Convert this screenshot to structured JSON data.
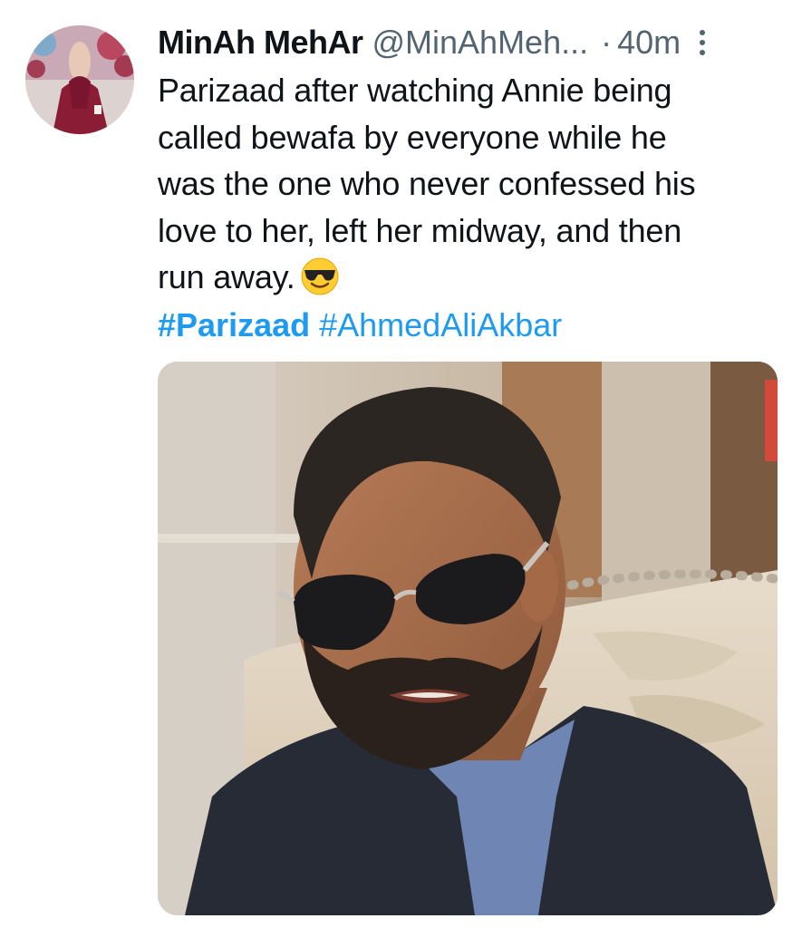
{
  "tweet": {
    "display_name": "MinAh MehAr",
    "handle": "@MinAhMeh...",
    "separator": "·",
    "time": "40m",
    "more_icon": "more-vertical-icon",
    "text_lines": [
      "Parizaad after watching Annie being",
      "called bewafa by everyone while he",
      "was the one who never confessed his",
      "love to her, left her midway, and then",
      "run away."
    ],
    "emoji": "smiling-face-with-sunglasses-icon",
    "hashtags": [
      "#Parizaad",
      "#AhmedAliAkbar"
    ]
  },
  "colors": {
    "link": "#1d9bf0",
    "secondary_text": "#536471",
    "primary_text": "#0f1419"
  }
}
